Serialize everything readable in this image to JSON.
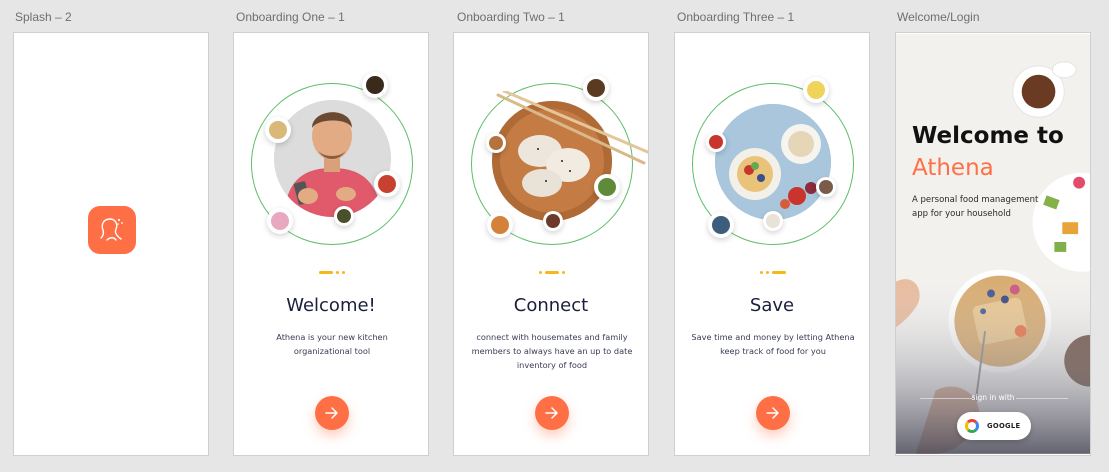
{
  "frames": {
    "splash": {
      "label": "Splash – 2",
      "logo_icon": "athena-logo-icon"
    },
    "onboarding_one": {
      "label": "Onboarding One – 1",
      "title": "Welcome!",
      "description": "Athena is your new kitchen organizational tool"
    },
    "onboarding_two": {
      "label": "Onboarding Two – 1",
      "title": "Connect",
      "description": "connect with housemates and family members to always have an up to date inventory of food"
    },
    "onboarding_three": {
      "label": "Onboarding Three – 1",
      "title": "Save",
      "description": "Save time and money by letting Athena keep track of food for you"
    },
    "welcome_login": {
      "label": "Welcome/Login",
      "title_line1": "Welcome to",
      "title_line2": "Athena",
      "description": "A personal food management app for your household",
      "signin_label": "sign in with",
      "google_label": "GOOGLE"
    }
  },
  "colors": {
    "accent": "#ff6f45",
    "ring": "#5cbf68",
    "indicator": "#f7b718",
    "title": "#1c1f3b"
  },
  "icons": {
    "next": "arrow-right-icon",
    "google": "google-icon"
  }
}
